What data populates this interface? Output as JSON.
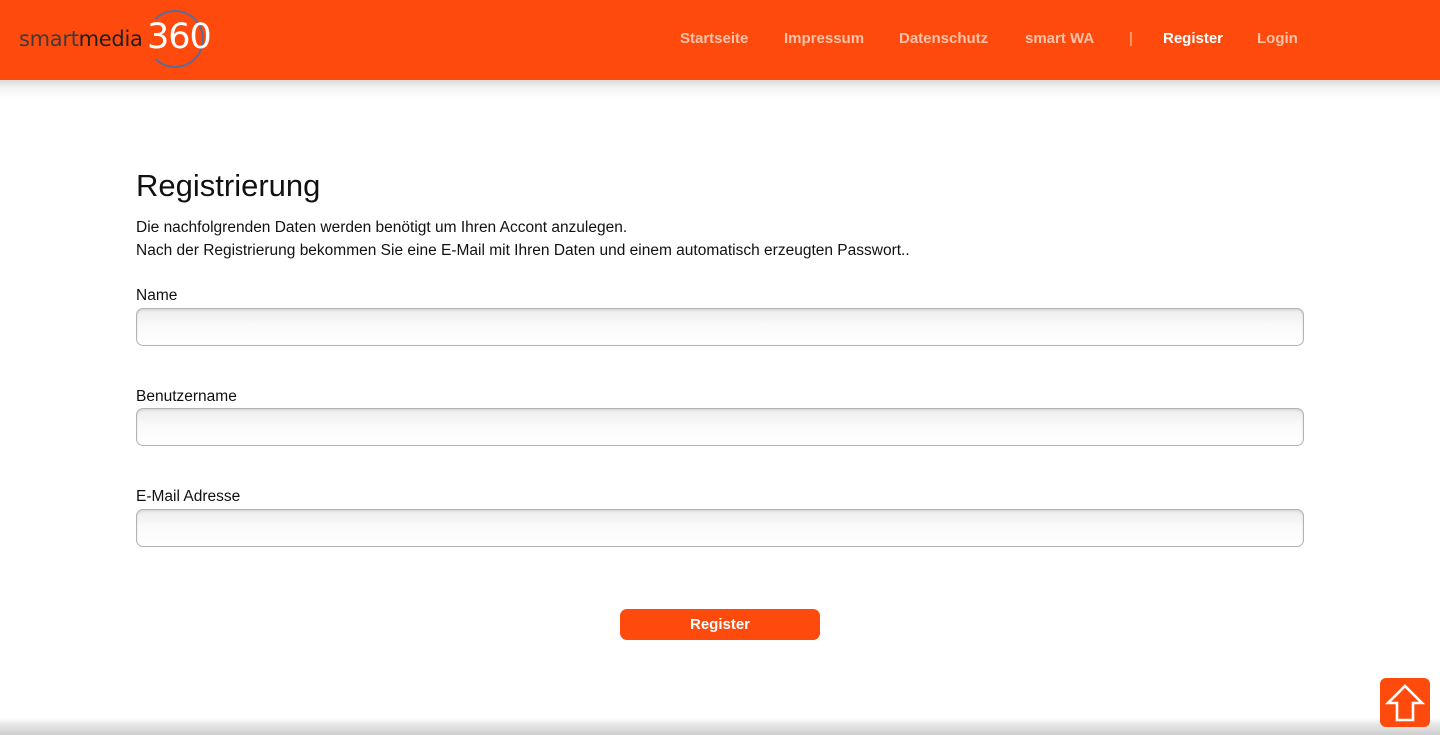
{
  "brand": {
    "logo_text_a": "smart",
    "logo_text_b": "media",
    "logo_number": "360"
  },
  "nav": {
    "items": [
      {
        "label": "Startseite"
      },
      {
        "label": "Impressum"
      },
      {
        "label": "Datenschutz"
      },
      {
        "label": "smart WA"
      },
      {
        "label": "Register",
        "active": true
      },
      {
        "label": "Login"
      }
    ],
    "separator": "|"
  },
  "page": {
    "title": "Registrierung",
    "intro_line1": "Die nachfolgrenden Daten werden benötigt um Ihren Accont anzulegen.",
    "intro_line2": "Nach der Registrierung bekommen Sie eine E-Mail mit Ihren Daten und einem automatisch erzeugten Passwort.."
  },
  "form": {
    "name_label": "Name",
    "name_value": "",
    "username_label": "Benutzername",
    "username_value": "",
    "email_label": "E-Mail Adresse",
    "email_value": "",
    "submit_label": "Register"
  },
  "colors": {
    "brand": "#fe4a0c",
    "nav_inactive": "#ffc2a8",
    "nav_active": "#ffffff"
  },
  "icons": {
    "scroll_top": "arrow-up-icon"
  }
}
